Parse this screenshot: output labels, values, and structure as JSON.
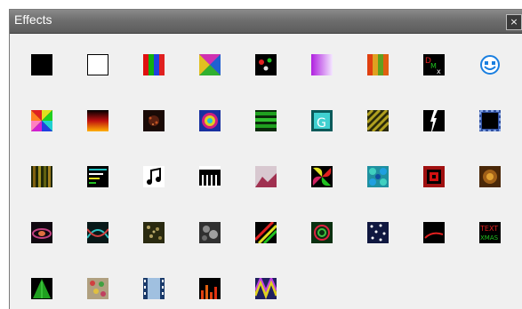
{
  "window": {
    "title": "Effects",
    "close_glyph": "×"
  },
  "effects": [
    "black-fill-icon",
    "white-fill-icon",
    "color-bars-icon",
    "crossfade-icon",
    "dots-icon",
    "gradient-icon",
    "vertical-bars-icon",
    "dmx-icon",
    "smiley-icon",
    "color-wheel-icon",
    "fire-icon",
    "fireworks-icon",
    "spiral-icon",
    "horizontal-bars-icon",
    "glediator-icon",
    "pattern-icon",
    "lightning-icon",
    "marquee-icon",
    "matrix-icon",
    "meteors-icon",
    "music-icon",
    "piano-icon",
    "pictures-icon",
    "pinwheel-icon",
    "plasma-icon",
    "ripple-icon",
    "shimmer-icon",
    "shockwave-icon",
    "single-strand-icon",
    "snowflakes-icon",
    "snowstorm-icon",
    "spirals-icon",
    "spirograph-icon",
    "stars-icon",
    "strobe-icon",
    "text-icon",
    "tree-icon",
    "twinkle-icon",
    "video-icon",
    "vu-meter-icon",
    "wave-icon"
  ]
}
